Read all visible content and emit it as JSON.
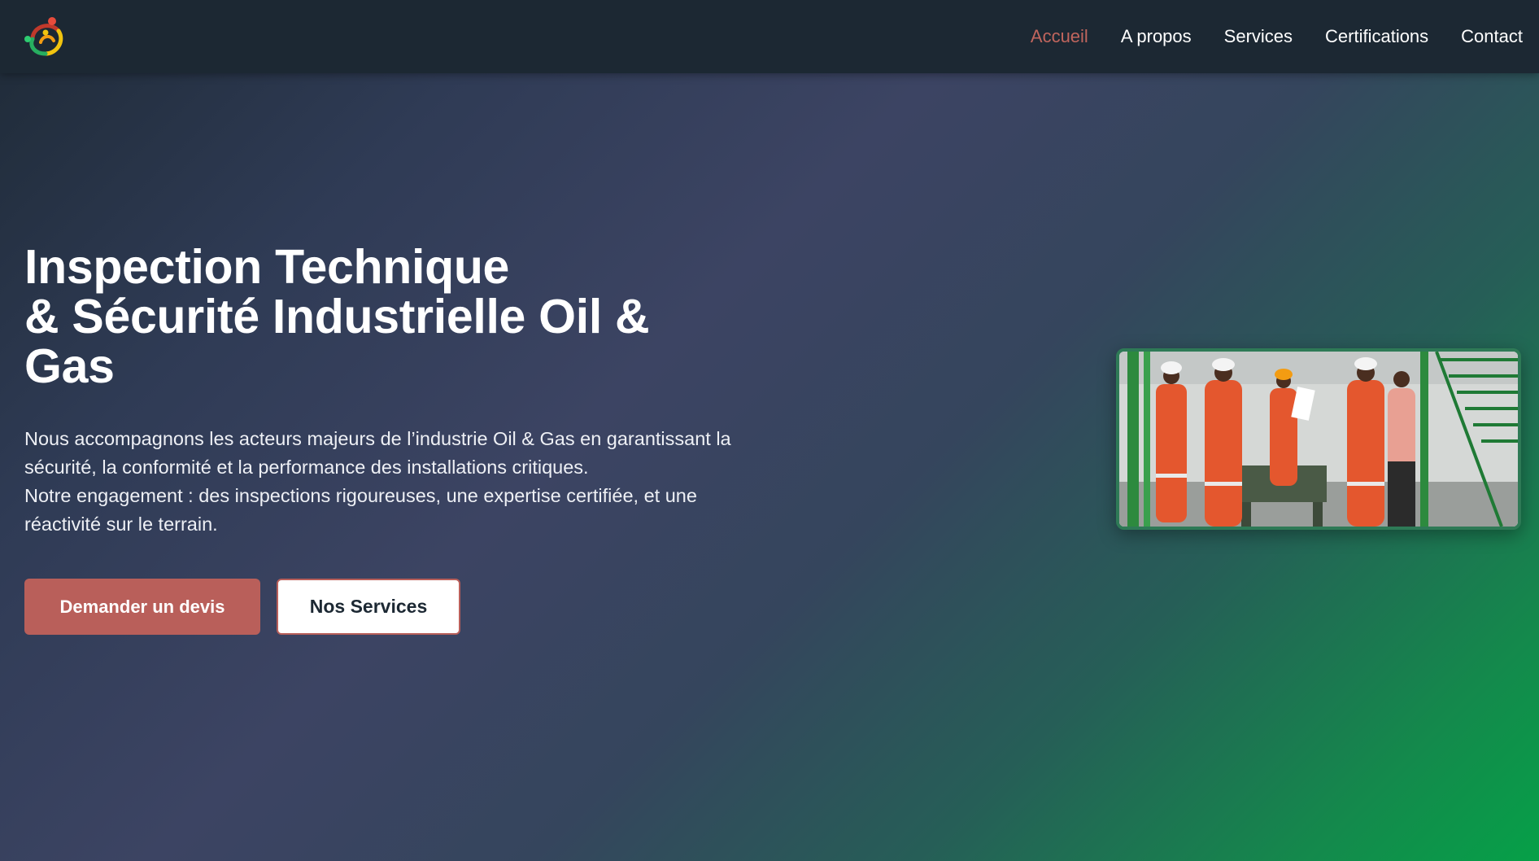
{
  "nav": {
    "logo_icon": "company-logo",
    "items": [
      {
        "label": "Accueil",
        "active": true
      },
      {
        "label": "A propos",
        "active": false
      },
      {
        "label": "Services",
        "active": false
      },
      {
        "label": "Certifications",
        "active": false
      },
      {
        "label": "Contact",
        "active": false
      }
    ]
  },
  "hero": {
    "title_lines": [
      "Inspection Technique",
      "& Sécurité Industrielle Oil &",
      "Gas"
    ],
    "text_lines": [
      "Nous accompagnons les acteurs majeurs de l’industrie Oil & Gas en garantissant la",
      "sécurité, la conformité et la performance des installations critiques.",
      "Notre engagement : des inspections rigoureuses, une expertise certifiée, et une",
      "réactivité sur le terrain."
    ],
    "primary_button": "Demander un devis",
    "secondary_button": "Nos Services",
    "image_icon": "inspection-team-photo"
  },
  "colors": {
    "accent": "#b95f5a",
    "active_link": "#c0655d",
    "nav_bg": "#1c2833",
    "gradient_end": "#06a048"
  }
}
